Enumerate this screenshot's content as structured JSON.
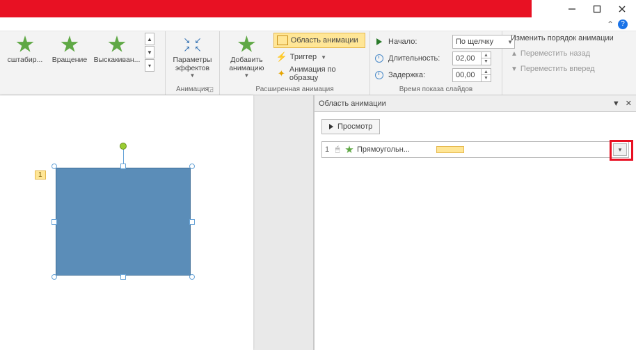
{
  "window": {
    "minimize": "",
    "maximize": "",
    "close": ""
  },
  "ribbon": {
    "gallery": {
      "scale": "сштабир...",
      "spin": "Вращение",
      "bounce": "Выскакиван..."
    },
    "effect_options": "Параметры эффектов",
    "animation_group_label": "Анимация",
    "advanced": {
      "add": "Добавить анимацию",
      "pane": "Область анимации",
      "trigger": "Триггер",
      "painter": "Анимация по образцу",
      "group_label": "Расширенная анимация"
    },
    "timing": {
      "start_label": "Начало:",
      "start_value": "По щелчку",
      "duration_label": "Длительность:",
      "duration_value": "02,00",
      "delay_label": "Задержка:",
      "delay_value": "00,00",
      "group_label": "Время показа слайдов"
    },
    "reorder": {
      "title": "Изменить порядок анимации",
      "back": "Переместить назад",
      "forward": "Переместить вперед"
    }
  },
  "canvas": {
    "shape_tag": "1"
  },
  "pane": {
    "title": "Область анимации",
    "preview": "Просмотр",
    "item": {
      "order": "1",
      "name": "Прямоугольн..."
    }
  }
}
